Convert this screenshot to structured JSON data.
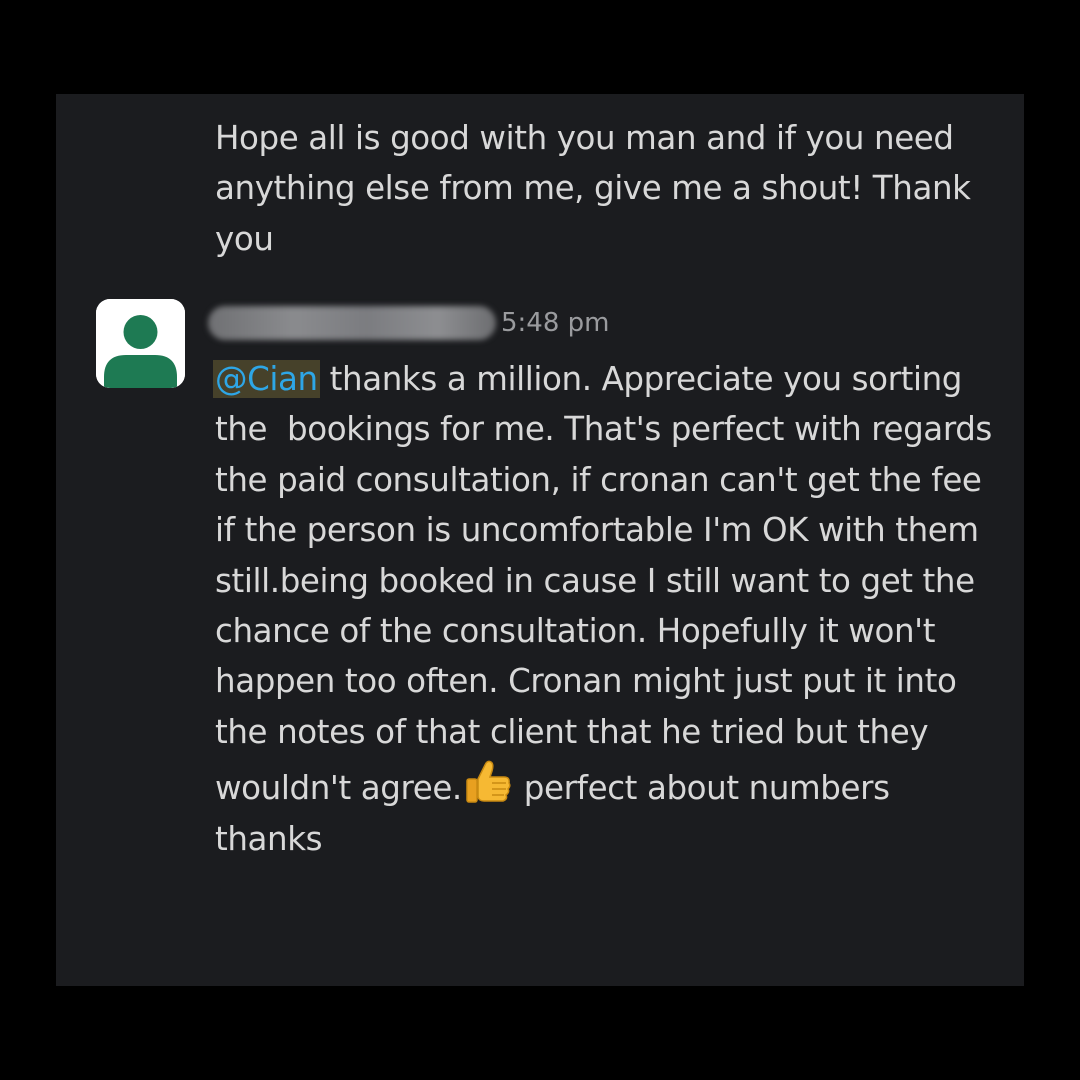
{
  "previous_message": {
    "text": "Hope all is good with you man and if you need anything else from me, give me a shout! Thank you"
  },
  "message": {
    "sender_name": "",
    "timestamp": "5:48 pm",
    "mention": "@Cian",
    "body_part1": " thanks a million. Appreciate you sorting the  bookings for me. That's perfect with regards the paid consultation, if cronan can't get the fee if the person is uncomfortable I'm OK with them still.being booked in cause I still want to get the chance of the consultation. Hopefully it won't happen too often. Cronan might just put it into the notes of that client that he tried but they wouldn't agree.",
    "emoji": "thumbs-up-emoji",
    "body_part2": " perfect about numbers thanks"
  },
  "colors": {
    "background": "#1b1c1f",
    "text": "#d8d8d8",
    "mention_text": "#2ea6e6",
    "mention_highlight": "#46412a",
    "avatar_green": "#1e7a53",
    "timestamp": "#9a9b9e"
  },
  "icons": {
    "avatar": "default-user-avatar-icon"
  }
}
